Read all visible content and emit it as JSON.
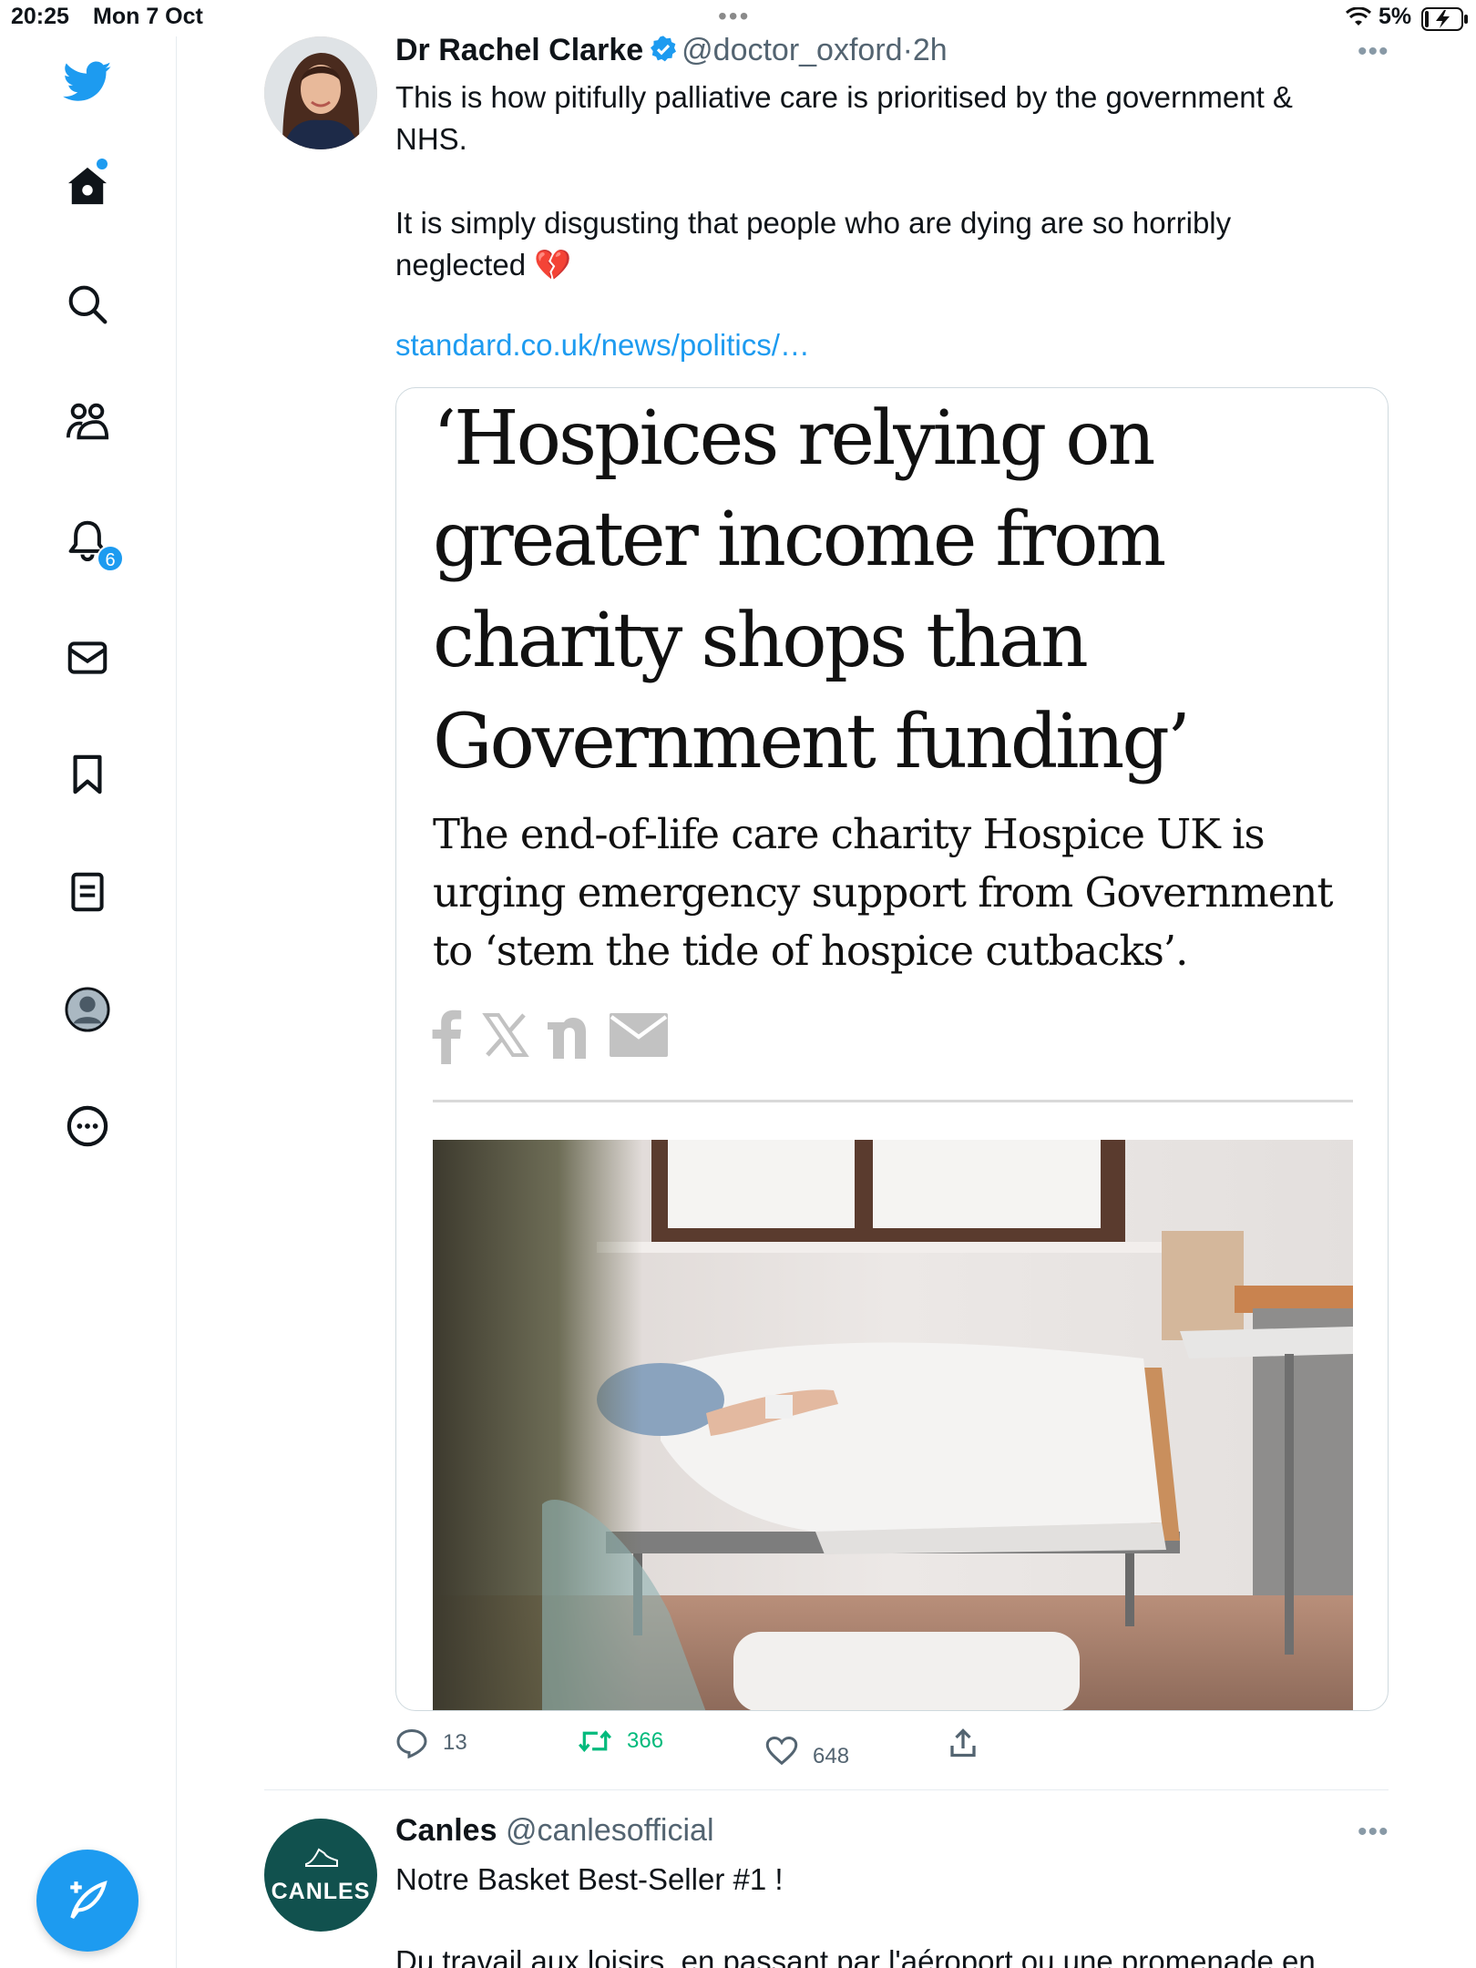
{
  "status_bar": {
    "time": "20:25",
    "date": "Mon 7 Oct",
    "battery": "5%"
  },
  "sidebar": {
    "items": [
      {
        "name": "home",
        "icon": "home-icon"
      },
      {
        "name": "explore",
        "icon": "search-icon"
      },
      {
        "name": "communities",
        "icon": "communities-icon"
      },
      {
        "name": "notifications",
        "icon": "bell-icon"
      },
      {
        "name": "messages",
        "icon": "mail-icon"
      },
      {
        "name": "bookmarks",
        "icon": "bookmark-icon"
      },
      {
        "name": "lists",
        "icon": "list-icon"
      },
      {
        "name": "profile",
        "icon": "profile-icon"
      },
      {
        "name": "more",
        "icon": "more-circle-icon"
      }
    ],
    "notifications_badge": "6",
    "accent": "#1d9bf0"
  },
  "tweet": {
    "author_name": "Dr Rachel Clarke",
    "handle": "@doctor_oxford",
    "separator": "·",
    "time": "2h",
    "text_1": "This is how pitifully palliative care is prioritised by the government & NHS.",
    "text_2": "It is simply disgusting that people who are dying are so horribly neglected 💔",
    "link": "standard.co.uk/news/politics/…",
    "card": {
      "headline": "‘Hospices relying on greater income from charity shops than Government funding’",
      "subheadline": "The end-of-life care charity Hospice UK is urging emergency support from Government to ‘stem the tide of hospice cutbacks’."
    },
    "stats": {
      "replies": "13",
      "retweets": "366",
      "likes": "648"
    }
  },
  "tweet2": {
    "author_name": "Canles",
    "handle": "@canlesofficial",
    "avatar_text": "CANLES",
    "text_1": "Notre Basket Best-Seller #1 !",
    "text_2": "Du travail aux loisirs, en passant par l'aéroport ou une promenade en"
  }
}
